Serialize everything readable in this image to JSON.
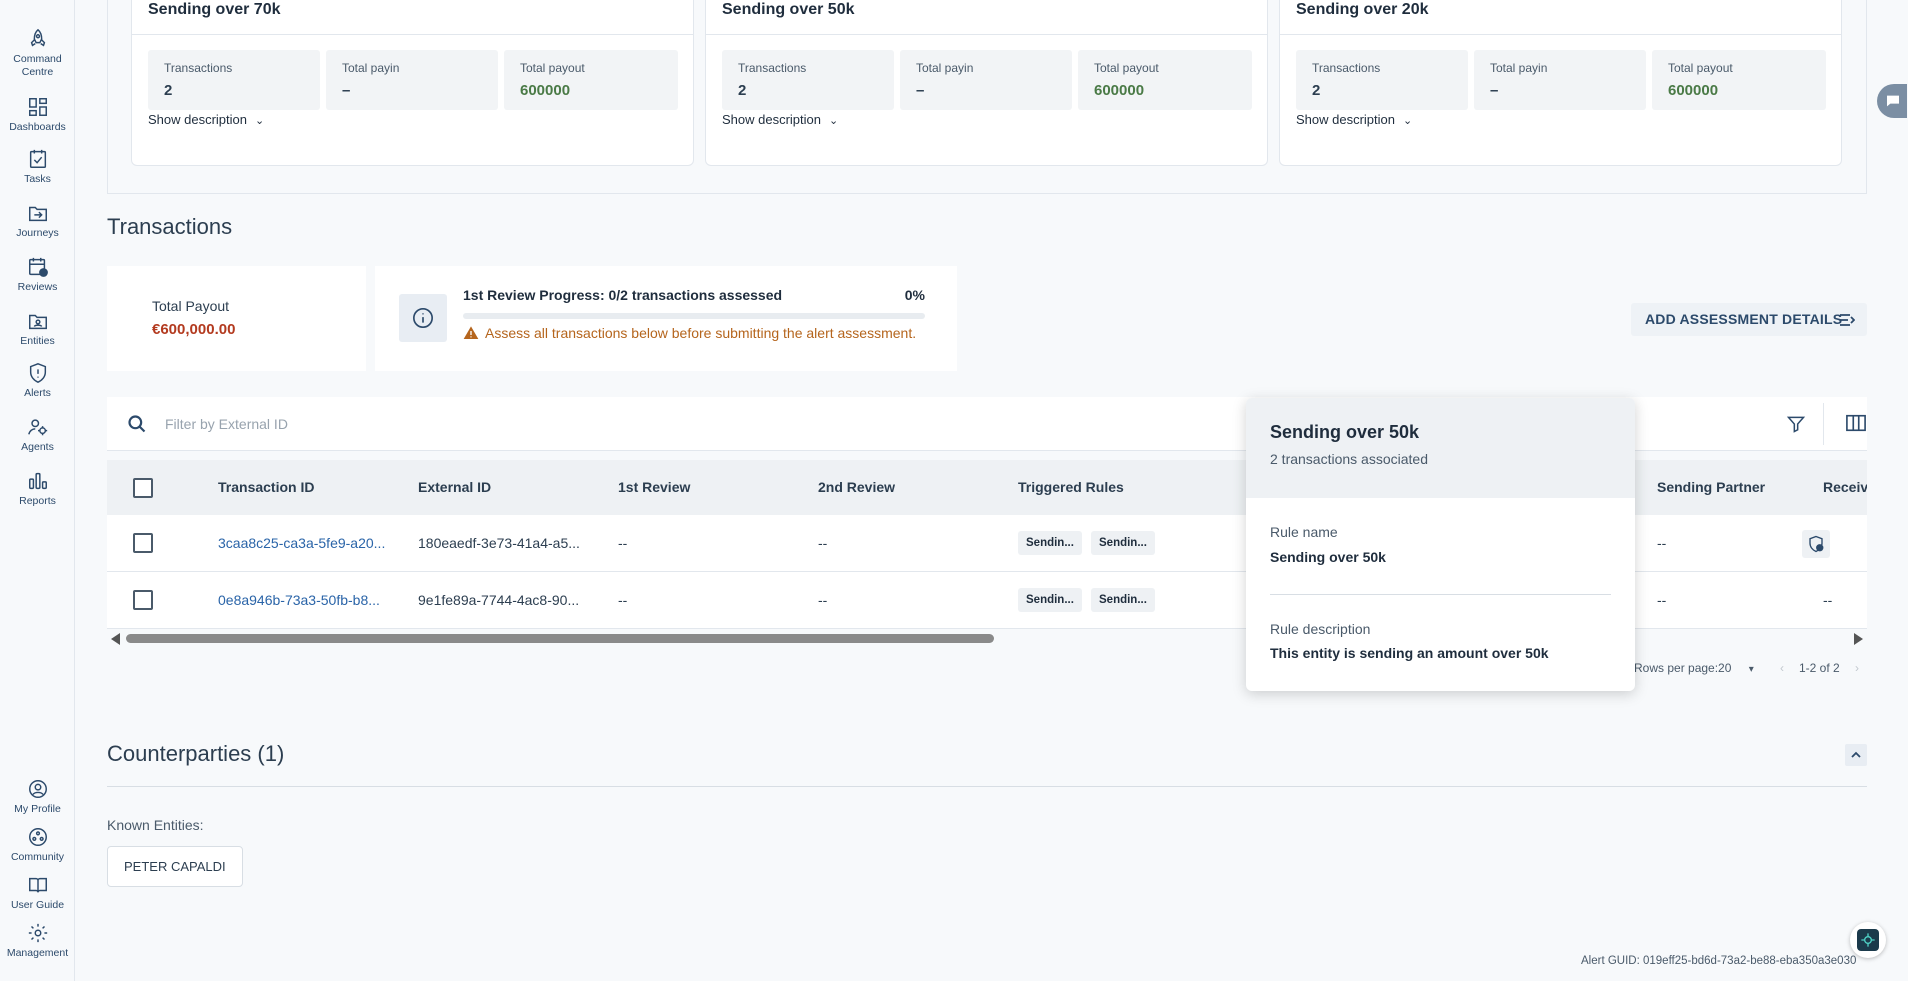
{
  "sidebar": {
    "items": [
      {
        "label": "Command Centre",
        "icon": "rocket-icon"
      },
      {
        "label": "Dashboards",
        "icon": "dashboard-grid-icon"
      },
      {
        "label": "Tasks",
        "icon": "task-check-icon"
      },
      {
        "label": "Journeys",
        "icon": "folder-arrow-icon"
      },
      {
        "label": "Reviews",
        "icon": "calendar-clock-icon"
      },
      {
        "label": "Entities",
        "icon": "folder-person-icon"
      },
      {
        "label": "Alerts",
        "icon": "shield-alert-icon"
      },
      {
        "label": "Agents",
        "icon": "agent-gear-icon"
      },
      {
        "label": "Reports",
        "icon": "bar-chart-icon"
      }
    ],
    "bottom_items": [
      {
        "label": "My Profile",
        "icon": "user-circle-icon"
      },
      {
        "label": "Community",
        "icon": "community-icon"
      },
      {
        "label": "User Guide",
        "icon": "book-icon"
      },
      {
        "label": "Management",
        "icon": "gear-icon"
      }
    ]
  },
  "rule_cards": [
    {
      "title": "Sending over 70k",
      "stats": [
        {
          "label": "Transactions",
          "value": "2"
        },
        {
          "label": "Total payin",
          "value": "–"
        },
        {
          "label": "Total payout",
          "value": "600000"
        }
      ],
      "show_description": "Show description"
    },
    {
      "title": "Sending over 50k",
      "stats": [
        {
          "label": "Transactions",
          "value": "2"
        },
        {
          "label": "Total payin",
          "value": "–"
        },
        {
          "label": "Total payout",
          "value": "600000"
        }
      ],
      "show_description": "Show description"
    },
    {
      "title": "Sending over 20k",
      "stats": [
        {
          "label": "Transactions",
          "value": "2"
        },
        {
          "label": "Total payin",
          "value": "–"
        },
        {
          "label": "Total payout",
          "value": "600000"
        }
      ],
      "show_description": "Show description"
    }
  ],
  "transactions": {
    "title": "Transactions",
    "total_payout_label": "Total Payout",
    "total_payout_value": "€600,000.00",
    "progress": {
      "title": "1st Review Progress: 0/2 transactions assessed",
      "percent_label": "0%",
      "fraction": 0,
      "warning": "Assess all transactions below before submitting the alert assessment."
    },
    "add_assessment_label": "ADD ASSESSMENT DETAILS",
    "filter_placeholder": "Filter by External ID",
    "columns": [
      "Transaction ID",
      "External ID",
      "1st Review",
      "2nd Review",
      "Triggered Rules",
      "Sending Partner",
      "Receiv"
    ],
    "rows": [
      {
        "transaction_id": "3caa8c25-ca3a-5fe9-a20...",
        "external_id": "180eaedf-3e73-41a4-a5...",
        "first_review": "--",
        "second_review": "--",
        "rules": [
          "Sendin...",
          "Sendin..."
        ],
        "sending_partner": "--",
        "receiving": ""
      },
      {
        "transaction_id": "0e8a946b-73a3-50fb-b8...",
        "external_id": "9e1fe89a-7744-4ac8-90...",
        "first_review": "--",
        "second_review": "--",
        "rules": [
          "Sendin...",
          "Sendin..."
        ],
        "sending_partner": "--",
        "receiving": "--"
      }
    ],
    "rows_per_page_label": "Rows per page:",
    "rows_per_page_value": "20",
    "range_label": "1-2 of 2"
  },
  "popover": {
    "title": "Sending over 50k",
    "subtitle": "2 transactions associated",
    "rule_name_label": "Rule name",
    "rule_name": "Sending over 50k",
    "rule_description_label": "Rule description",
    "rule_description": "This entity is sending an amount over 50k"
  },
  "counterparties": {
    "title": "Counterparties (1)",
    "known_label": "Known Entities:",
    "entities": [
      "PETER CAPALDI"
    ]
  },
  "alert_guid": "Alert GUID: 019eff25-bd6d-73a2-be88-eba350a3e030",
  "colors": {
    "accent": "#2c4a6b",
    "link": "#2a64a8",
    "payout_red": "#b33a1f",
    "positive_green": "#4a7a46",
    "warning": "#b5651d"
  }
}
